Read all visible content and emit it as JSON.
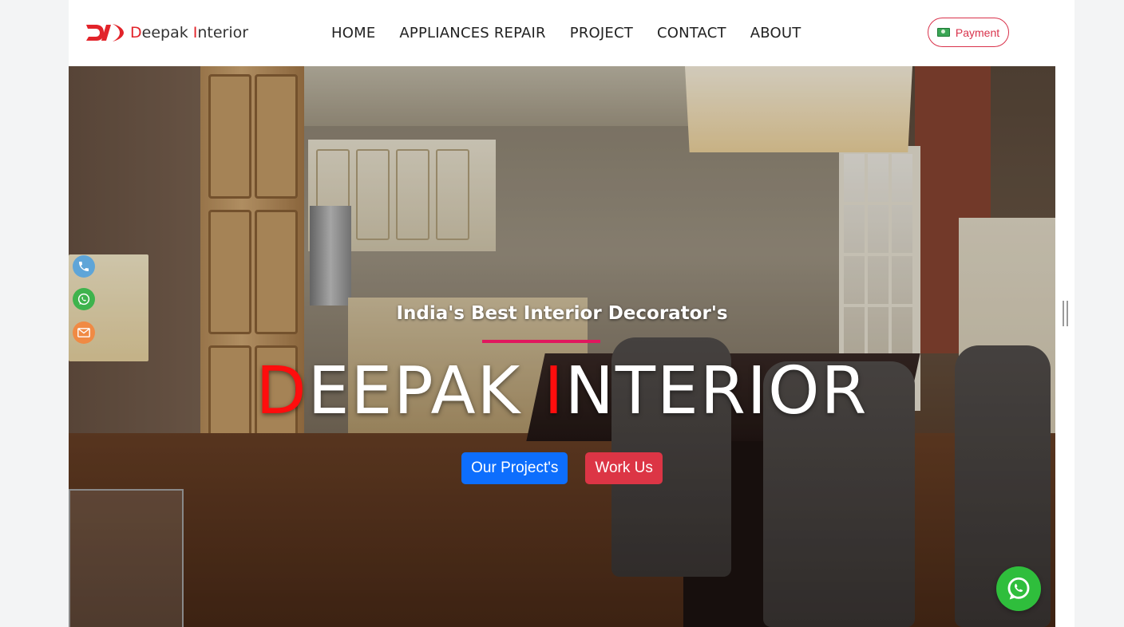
{
  "brand": {
    "logo_text": "DI",
    "name_first_initial": "D",
    "name_first_rest": "eepak ",
    "name_second_initial": "I",
    "name_second_rest": "nterior"
  },
  "nav": {
    "items": [
      "HOME",
      "APPLIANCES REPAIR",
      "PROJECT",
      "CONTACT",
      "ABOUT"
    ]
  },
  "payment": {
    "label": "Payment",
    "icon": "money-icon"
  },
  "hero": {
    "subtitle": "India's Best Interior Decorator's",
    "title_part1_initial": "D",
    "title_part1_rest": "EEPAK ",
    "title_part2_initial": "I",
    "title_part2_rest": "NTERIOR",
    "buttons": {
      "projects": "Our Project's",
      "work": "Work Us"
    }
  },
  "side_contact": [
    "phone-icon",
    "whatsapp-icon",
    "mail-icon"
  ],
  "colors": {
    "accent_red": "#e2232a",
    "title_red": "#ff0d0d",
    "primary_blue": "#0d6efd",
    "danger_red": "#dc3545",
    "divider_pink": "#e0175e",
    "whatsapp_green": "#2fbe3c"
  }
}
